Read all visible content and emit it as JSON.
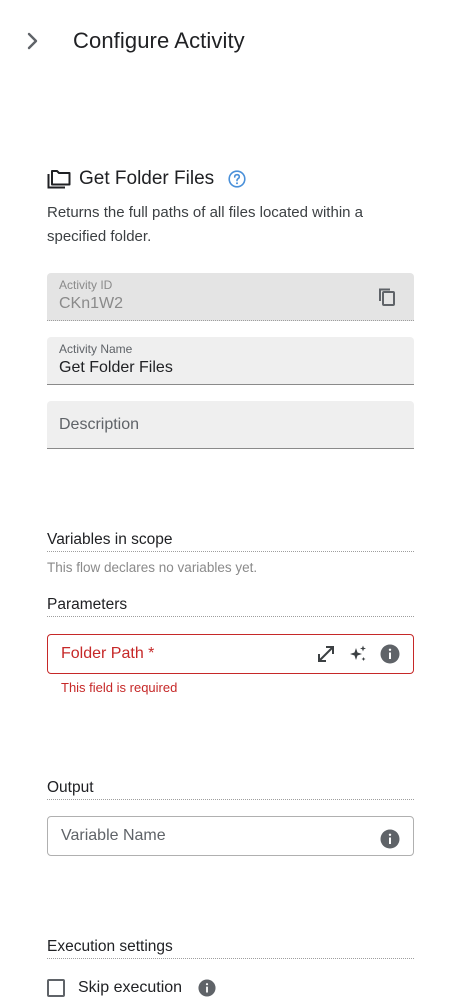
{
  "header": {
    "title": "Configure Activity",
    "collapse_icon": "chevron-right-icon"
  },
  "activity": {
    "title": "Get Folder Files",
    "icon": "folder-copy-icon",
    "help_icon": "help-circle-icon",
    "description": "Returns the full paths of all files located within a specified folder."
  },
  "fields": {
    "activity_id": {
      "label": "Activity ID",
      "value": "CKn1W2",
      "copy_icon": "copy-icon"
    },
    "activity_name": {
      "label": "Activity Name",
      "value": "Get Folder Files"
    },
    "description": {
      "placeholder": "Description"
    }
  },
  "variables": {
    "title": "Variables in scope",
    "hint": "This flow declares no variables yet."
  },
  "parameters": {
    "title": "Parameters",
    "folder_path": {
      "label": "Folder Path *",
      "error": "This field is required"
    }
  },
  "output": {
    "title": "Output",
    "variable_placeholder": "Variable Name"
  },
  "execution": {
    "title": "Execution settings",
    "skip_label": "Skip execution",
    "skip_checked": false
  },
  "colors": {
    "error": "#c62828",
    "accent": "#4a90d9",
    "field_bg": "#efefef"
  }
}
